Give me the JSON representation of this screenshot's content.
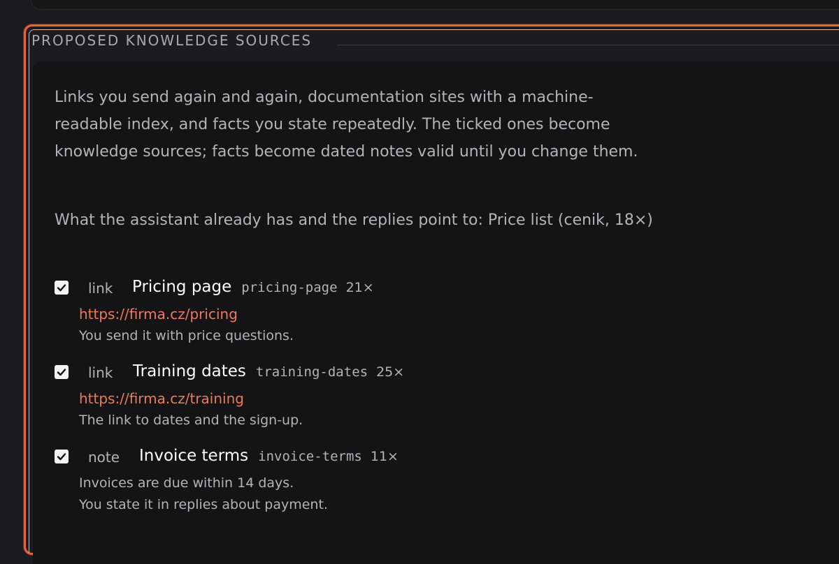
{
  "section": {
    "title": "PROPOSED KNOWLEDGE SOURCES",
    "intro": "Links you send again and again, documentation sites with a machine-readable index, and facts you state repeatedly. The ticked ones become knowledge sources; facts become dated notes valid until you change them.",
    "existing": "What the assistant already has and the replies point to: Price list (cenik, 18×)"
  },
  "items": [
    {
      "checked": true,
      "kind": "link",
      "title": "Pricing page",
      "slug": "pricing-page",
      "count": "21×",
      "url": "https://firma.cz/pricing",
      "description": "You send it with price questions."
    },
    {
      "checked": true,
      "kind": "link",
      "title": "Training dates",
      "slug": "training-dates",
      "count": "25×",
      "url": "https://firma.cz/training",
      "description": "The link to dates and the sign-up."
    },
    {
      "checked": true,
      "kind": "note",
      "title": "Invoice terms",
      "slug": "invoice-terms",
      "count": "11×",
      "fact": "Invoices are due within 14 days.",
      "description": "You state it in replies about payment."
    }
  ],
  "colors": {
    "accent": "#e8623e",
    "link": "#ec7a5c",
    "background": "#141316"
  },
  "icons": {
    "checkbox": "checkmark-icon"
  }
}
